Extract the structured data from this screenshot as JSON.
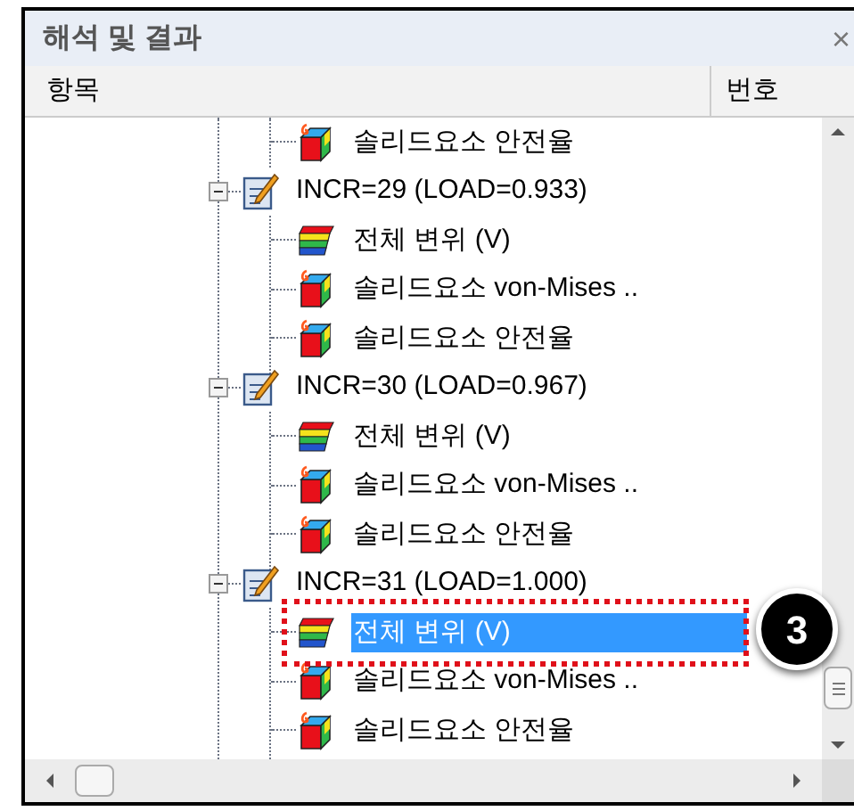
{
  "panel": {
    "title": "해석 및 결과",
    "close": "×"
  },
  "columns": [
    "항목",
    "번호"
  ],
  "tree": {
    "continued_children": [
      {
        "kind": "safety",
        "label": "솔리드요소 안전율",
        "selected": false
      }
    ],
    "nodes": [
      {
        "label": "INCR=29 (LOAD=0.933)",
        "expanded": true,
        "children": [
          {
            "kind": "displacement",
            "label": "전체 변위 (V)",
            "selected": false
          },
          {
            "kind": "stress",
            "label": "솔리드요소 von-Mises ..",
            "selected": false
          },
          {
            "kind": "safety",
            "label": "솔리드요소 안전율",
            "selected": false
          }
        ]
      },
      {
        "label": "INCR=30 (LOAD=0.967)",
        "expanded": true,
        "children": [
          {
            "kind": "displacement",
            "label": "전체 변위 (V)",
            "selected": false
          },
          {
            "kind": "stress",
            "label": "솔리드요소 von-Mises ..",
            "selected": false
          },
          {
            "kind": "safety",
            "label": "솔리드요소 안전율",
            "selected": false
          }
        ]
      },
      {
        "label": "INCR=31 (LOAD=1.000)",
        "expanded": true,
        "children": [
          {
            "kind": "displacement",
            "label": "전체 변위 (V)",
            "selected": true
          },
          {
            "kind": "stress",
            "label": "솔리드요소 von-Mises ..",
            "selected": false
          },
          {
            "kind": "safety",
            "label": "솔리드요소 안전율",
            "selected": false
          }
        ]
      }
    ]
  },
  "callout": {
    "label": "3"
  }
}
